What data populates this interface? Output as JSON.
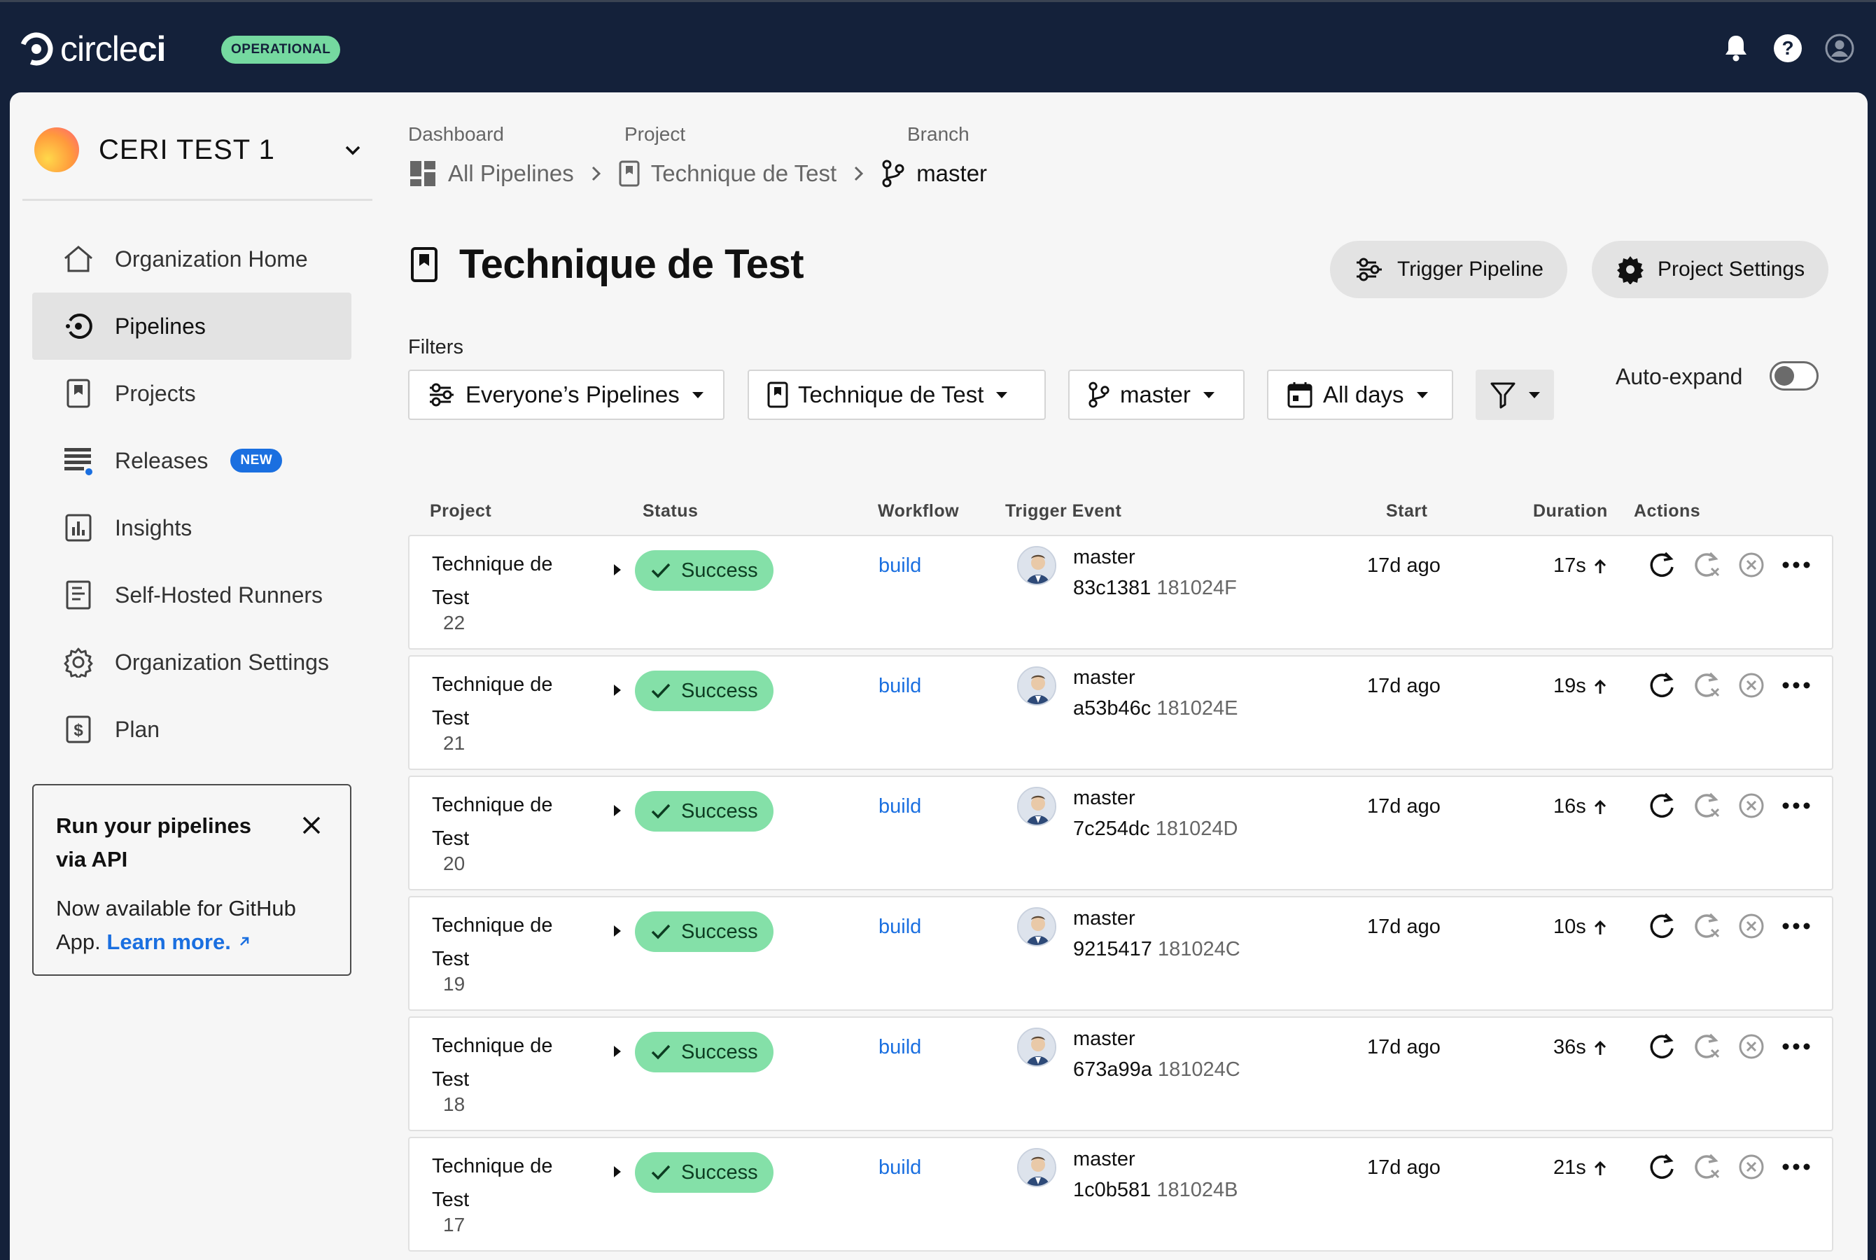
{
  "topbar": {
    "logo_prefix": "circle",
    "logo_suffix": "ci",
    "status_label": "OPERATIONAL"
  },
  "org": {
    "name": "CERI TEST 1"
  },
  "nav": [
    {
      "label": "Organization Home",
      "icon": "home-icon"
    },
    {
      "label": "Pipelines",
      "icon": "pipelines-icon",
      "active": true
    },
    {
      "label": "Projects",
      "icon": "project-icon"
    },
    {
      "label": "Releases",
      "icon": "releases-icon",
      "badge": "NEW"
    },
    {
      "label": "Insights",
      "icon": "insights-icon"
    },
    {
      "label": "Self-Hosted Runners",
      "icon": "runners-icon"
    },
    {
      "label": "Organization Settings",
      "icon": "gear-icon"
    },
    {
      "label": "Plan",
      "icon": "dollar-icon"
    }
  ],
  "promo": {
    "title": "Run your pipelines via API",
    "body": "Now available for GitHub App.",
    "link": "Learn more."
  },
  "breadcrumbs": {
    "labels": [
      "Dashboard",
      "Project",
      "Branch"
    ],
    "items": [
      "All Pipelines",
      "Technique de Test",
      "master"
    ]
  },
  "page": {
    "title": "Technique de Test",
    "trigger_button": "Trigger Pipeline",
    "settings_button": "Project Settings"
  },
  "filters": {
    "label": "Filters",
    "pipelines": "Everyone’s Pipelines",
    "project": "Technique de Test",
    "branch": "master",
    "days": "All days",
    "auto_expand_label": "Auto-expand",
    "auto_expand_on": false
  },
  "table": {
    "headers": [
      "Project",
      "Status",
      "Workflow",
      "Trigger Event",
      "Start",
      "Duration",
      "Actions"
    ],
    "rows": [
      {
        "project": "Technique de Test",
        "number": "22",
        "status": "Success",
        "workflow": "build",
        "branch": "master",
        "commit": "83c1381",
        "message": "181024F",
        "start": "17d ago",
        "duration": "17s"
      },
      {
        "project": "Technique de Test",
        "number": "21",
        "status": "Success",
        "workflow": "build",
        "branch": "master",
        "commit": "a53b46c",
        "message": "181024E",
        "start": "17d ago",
        "duration": "19s"
      },
      {
        "project": "Technique de Test",
        "number": "20",
        "status": "Success",
        "workflow": "build",
        "branch": "master",
        "commit": "7c254dc",
        "message": "181024D",
        "start": "17d ago",
        "duration": "16s"
      },
      {
        "project": "Technique de Test",
        "number": "19",
        "status": "Success",
        "workflow": "build",
        "branch": "master",
        "commit": "9215417",
        "message": "181024C",
        "start": "17d ago",
        "duration": "10s"
      },
      {
        "project": "Technique de Test",
        "number": "18",
        "status": "Success",
        "workflow": "build",
        "branch": "master",
        "commit": "673a99a",
        "message": "181024C",
        "start": "17d ago",
        "duration": "36s"
      },
      {
        "project": "Technique de Test",
        "number": "17",
        "status": "Success",
        "workflow": "build",
        "branch": "master",
        "commit": "1c0b581",
        "message": "181024B",
        "start": "17d ago",
        "duration": "21s"
      }
    ]
  },
  "colors": {
    "topbar": "#14213a",
    "success": "#84e0a8",
    "link": "#1a6fe0",
    "operational": "#75d9a0"
  }
}
